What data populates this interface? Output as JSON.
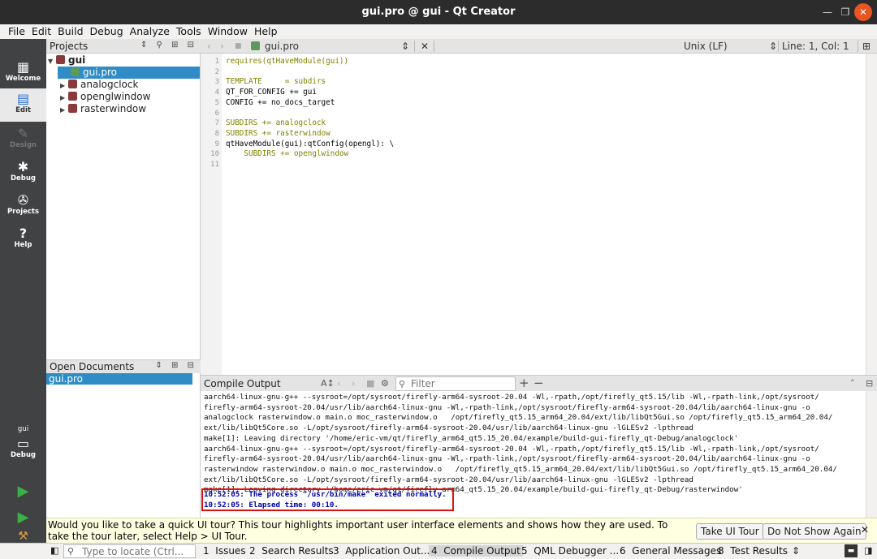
{
  "window": {
    "title": "gui.pro @ gui - Qt Creator"
  },
  "menu": [
    "File",
    "Edit",
    "Build",
    "Debug",
    "Analyze",
    "Tools",
    "Window",
    "Help"
  ],
  "modes": [
    {
      "label": "Welcome",
      "icon": "grid-icon"
    },
    {
      "label": "Edit",
      "icon": "edit-icon"
    },
    {
      "label": "Design",
      "icon": "pencil-icon"
    },
    {
      "label": "Debug",
      "icon": "bug-icon"
    },
    {
      "label": "Projects",
      "icon": "wrench-icon"
    },
    {
      "label": "Help",
      "icon": "help-icon"
    }
  ],
  "kit": {
    "project": "gui",
    "label": "Debug"
  },
  "projects": {
    "title": "Projects",
    "tree": [
      {
        "label": "gui",
        "expanded": true
      },
      {
        "label": "gui.pro",
        "selected": true
      },
      {
        "label": "analogclock"
      },
      {
        "label": "openglwindow"
      },
      {
        "label": "rasterwindow"
      }
    ]
  },
  "open_documents": {
    "title": "Open Documents",
    "items": [
      "gui.pro"
    ]
  },
  "editor": {
    "file": "gui.pro",
    "line_ending": "Unix (LF)",
    "position": "Line: 1, Col: 1",
    "line_numbers": [
      "1",
      "2",
      "3",
      "4",
      "5",
      "6",
      "7",
      "8",
      "9",
      "10",
      "11"
    ],
    "lines": [
      "requires(qtHaveModule(gui))",
      "",
      "TEMPLATE     = subdirs",
      "QT_FOR_CONFIG += gui",
      "CONFIG += no_docs_target",
      "",
      "SUBDIRS += analogclock",
      "SUBDIRS += rasterwindow",
      "qtHaveModule(gui):qtConfig(opengl): \\",
      "    SUBDIRS += openglwindow",
      ""
    ]
  },
  "compile_output": {
    "title": "Compile Output",
    "filter_placeholder": "Filter",
    "lines": [
      "aarch64-linux-gnu-g++ --sysroot=/opt/sysroot/firefly-arm64-sysroot-20.04 -Wl,-rpath,/opt/firefly_qt5.15/lib -Wl,-rpath-link,/opt/sysroot/",
      "firefly-arm64-sysroot-20.04/usr/lib/aarch64-linux-gnu -Wl,-rpath-link,/opt/sysroot/firefly-arm64-sysroot-20.04/lib/aarch64-linux-gnu -o",
      "analogclock rasterwindow.o main.o moc_rasterwindow.o   /opt/firefly_qt5.15_arm64_20.04/ext/lib/libQt5Gui.so /opt/firefly_qt5.15_arm64_20.04/",
      "ext/lib/libQt5Core.so -L/opt/sysroot/firefly-arm64-sysroot-20.04/usr/lib/aarch64-linux-gnu -lGLESv2 -lpthread",
      "make[1]: Leaving directory '/home/eric-vm/qt/firefly_arm64_qt5.15_20.04/example/build-gui-firefly_qt-Debug/analogclock'",
      "aarch64-linux-gnu-g++ --sysroot=/opt/sysroot/firefly-arm64-sysroot-20.04 -Wl,-rpath,/opt/firefly_qt5.15/lib -Wl,-rpath-link,/opt/sysroot/",
      "firefly-arm64-sysroot-20.04/usr/lib/aarch64-linux-gnu -Wl,-rpath-link,/opt/sysroot/firefly-arm64-sysroot-20.04/lib/aarch64-linux-gnu -o",
      "rasterwindow rasterwindow.o main.o moc_rasterwindow.o   /opt/firefly_qt5.15_arm64_20.04/ext/lib/libQt5Gui.so /opt/firefly_qt5.15_arm64_20.04/",
      "ext/lib/libQt5Core.so -L/opt/sysroot/firefly-arm64-sysroot-20.04/usr/lib/aarch64-linux-gnu -lGLESv2 -lpthread",
      "make[1]: Leaving directory '/home/eric-vm/qt/firefly_arm64_qt5.15_20.04/example/build-gui-firefly_qt-Debug/rasterwindow'"
    ],
    "status_lines": [
      "10:52:05: The process \"/usr/bin/make\" exited normally.",
      "10:52:05: Elapsed time: 00:10."
    ]
  },
  "tour": {
    "message": "Would you like to take a quick UI tour? This tour highlights important user interface elements and shows how they are used. To take the tour later, select Help > UI Tour.",
    "take_label": "Take UI Tour",
    "dismiss_label": "Do Not Show Again"
  },
  "statusbar": {
    "locate_placeholder": "Type to locate (Ctrl...",
    "tabs": [
      {
        "num": "1",
        "label": "Issues"
      },
      {
        "num": "2",
        "label": "Search Results"
      },
      {
        "num": "3",
        "label": "Application Out..."
      },
      {
        "num": "4",
        "label": "Compile Output",
        "active": true
      },
      {
        "num": "5",
        "label": "QML Debugger ..."
      },
      {
        "num": "6",
        "label": "General Messages"
      },
      {
        "num": "8",
        "label": "Test Results"
      }
    ]
  },
  "colors": {
    "selection": "#308cc6",
    "modebar": "#404244",
    "highlight_box": "#e01010",
    "status_text": "#0000aa"
  }
}
